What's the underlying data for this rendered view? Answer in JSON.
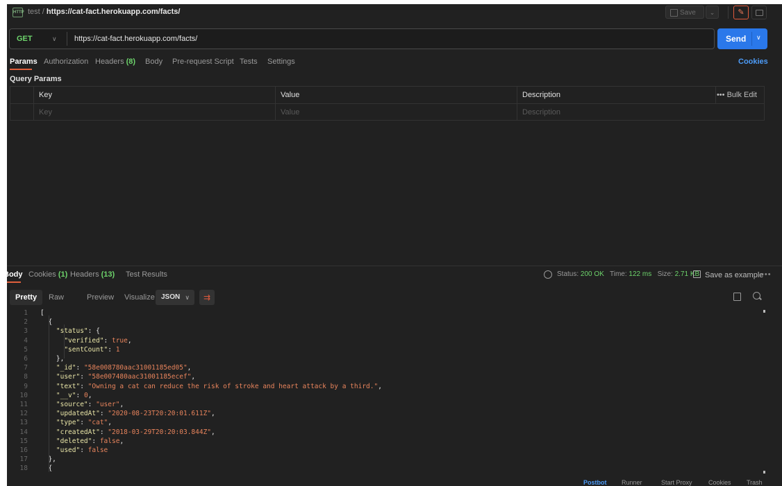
{
  "header": {
    "icon_label": "HTTP",
    "collection": "test",
    "separator": "/",
    "request_name": "https://cat-fact.herokuapp.com/facts/",
    "save_label": "Save"
  },
  "request": {
    "method": "GET",
    "url": "https://cat-fact.herokuapp.com/facts/",
    "send_label": "Send"
  },
  "request_tabs": [
    {
      "label": "Params",
      "count": ""
    },
    {
      "label": "Authorization",
      "count": ""
    },
    {
      "label": "Headers",
      "count": "(8)"
    },
    {
      "label": "Body",
      "count": ""
    },
    {
      "label": "Pre-request Script",
      "count": ""
    },
    {
      "label": "Tests",
      "count": ""
    },
    {
      "label": "Settings",
      "count": ""
    }
  ],
  "cookies_link": "Cookies",
  "query_params": {
    "title": "Query Params",
    "headers": [
      "Key",
      "Value",
      "Description"
    ],
    "bulk_edit": "Bulk Edit",
    "placeholders": [
      "Key",
      "Value",
      "Description"
    ]
  },
  "response": {
    "tabs": [
      {
        "label": "Body",
        "count": ""
      },
      {
        "label": "Cookies",
        "count": "(1)"
      },
      {
        "label": "Headers",
        "count": "(13)"
      },
      {
        "label": "Test Results",
        "count": ""
      }
    ],
    "status_label": "Status:",
    "status_value": "200 OK",
    "time_label": "Time:",
    "time_value": "122 ms",
    "size_label": "Size:",
    "size_value": "2.71 KB",
    "save_example": "Save as example",
    "view_tabs": [
      "Pretty",
      "Raw",
      "Preview",
      "Visualize"
    ],
    "format": "JSON",
    "code_lines": [
      "[",
      "  {",
      "    \"status\": {",
      "      \"verified\": true,",
      "      \"sentCount\": 1",
      "    },",
      "    \"_id\": \"58e008780aac31001185ed05\",",
      "    \"user\": \"58e007480aac31001185ecef\",",
      "    \"text\": \"Owning a cat can reduce the risk of stroke and heart attack by a third.\",",
      "    \"__v\": 0,",
      "    \"source\": \"user\",",
      "    \"updatedAt\": \"2020-08-23T20:20:01.611Z\",",
      "    \"type\": \"cat\",",
      "    \"createdAt\": \"2018-03-29T20:20:03.844Z\",",
      "    \"deleted\": false,",
      "    \"used\": false",
      "  },",
      "  {"
    ]
  },
  "statusbar": [
    "Postbot",
    "Runner",
    "Start Proxy",
    "Cookies",
    "Trash"
  ],
  "colors": {
    "accent_orange": "#e0603c",
    "send_blue": "#2a78ea",
    "method_green": "#6dd36b",
    "link_blue": "#4d9cf8",
    "background": "#212121"
  },
  "icons": [
    "http-icon",
    "save-icon",
    "chevron-down-icon",
    "pencil-icon",
    "comment-icon",
    "globe-icon",
    "copy-icon",
    "search-icon",
    "wrap-lines-icon",
    "more-icon"
  ]
}
